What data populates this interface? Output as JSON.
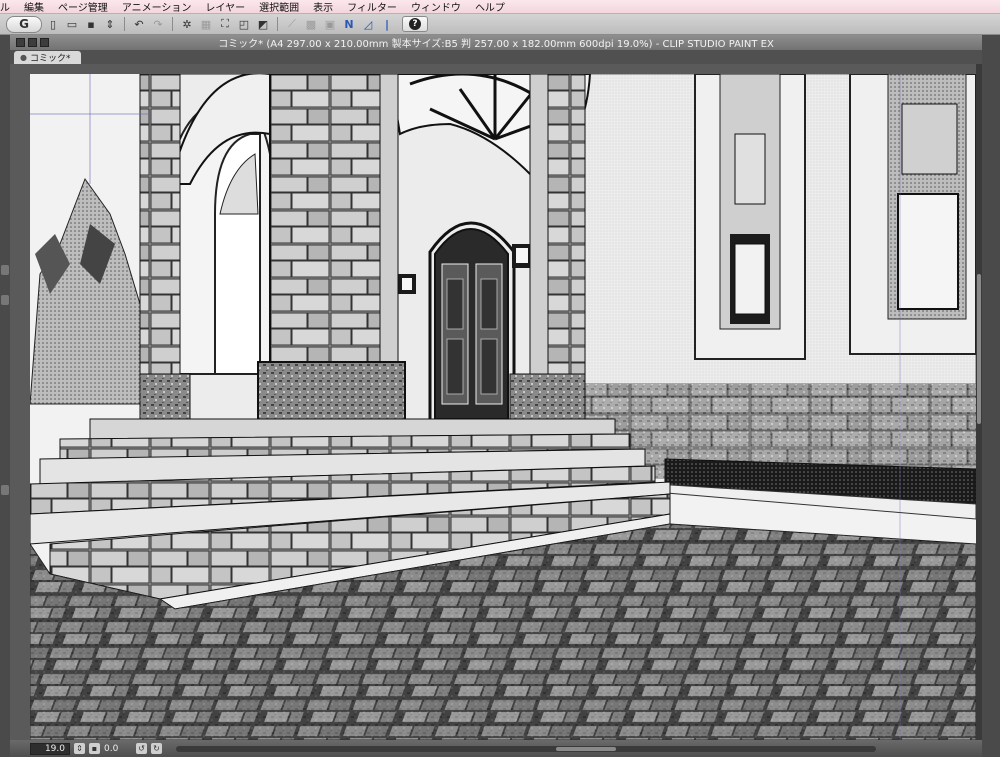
{
  "menu": [
    "ル",
    "編集",
    "ページ管理",
    "アニメーション",
    "レイヤー",
    "選択範囲",
    "表示",
    "フィルター",
    "ウィンドウ",
    "ヘルプ"
  ],
  "toolbar": {
    "help_glyph": "?"
  },
  "window": {
    "title": "コミック* (A4 297.00 x 210.00mm 製本サイズ:B5 判 257.00 x 182.00mm 600dpi 19.0%)  - CLIP STUDIO PAINT EX",
    "tab_label": "コミック*"
  },
  "status": {
    "zoom": "19.0",
    "angle": "0.0"
  },
  "colors": {
    "menubar": "#f3d6de",
    "toolbar": "#c8c8c8",
    "titlebar": "#7f7f7f",
    "chrome": "#4a4a4a"
  }
}
